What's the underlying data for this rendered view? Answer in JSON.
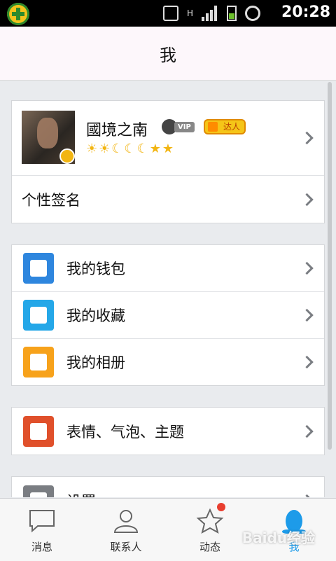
{
  "status_bar": {
    "time": "20:28",
    "network_type": "H",
    "icons": [
      "app-icon",
      "vibrate-icon",
      "signal-icon",
      "battery-icon",
      "alarm-icon"
    ]
  },
  "header": {
    "title": "我"
  },
  "profile": {
    "nickname": "國境之南",
    "vip_label": "VIP",
    "daren_label": "达人",
    "level_icons": [
      "sun",
      "sun",
      "moon",
      "moon",
      "moon",
      "star",
      "star"
    ]
  },
  "signature_row": {
    "label": "个性签名"
  },
  "menu_group_1": [
    {
      "label": "我的钱包",
      "icon": "wallet-icon",
      "color": "#2e86de"
    },
    {
      "label": "我的收藏",
      "icon": "favorites-icon",
      "color": "#24a7e8"
    },
    {
      "label": "我的相册",
      "icon": "album-icon",
      "color": "#f7a21b"
    }
  ],
  "menu_group_2": [
    {
      "label": "表情、气泡、主题",
      "icon": "theme-icon",
      "color": "#e0502b"
    }
  ],
  "menu_group_3": [
    {
      "label": "设置",
      "icon": "settings-icon",
      "color": "#7a7d82"
    }
  ],
  "tabbar": {
    "tabs": [
      {
        "label": "消息",
        "icon": "message-icon"
      },
      {
        "label": "联系人",
        "icon": "contacts-icon"
      },
      {
        "label": "动态",
        "icon": "star-icon"
      },
      {
        "label": "我",
        "icon": "qq-penguin-icon"
      }
    ],
    "active_index": 3,
    "accent": "#1d9be9"
  },
  "watermark": "Baidu经验"
}
